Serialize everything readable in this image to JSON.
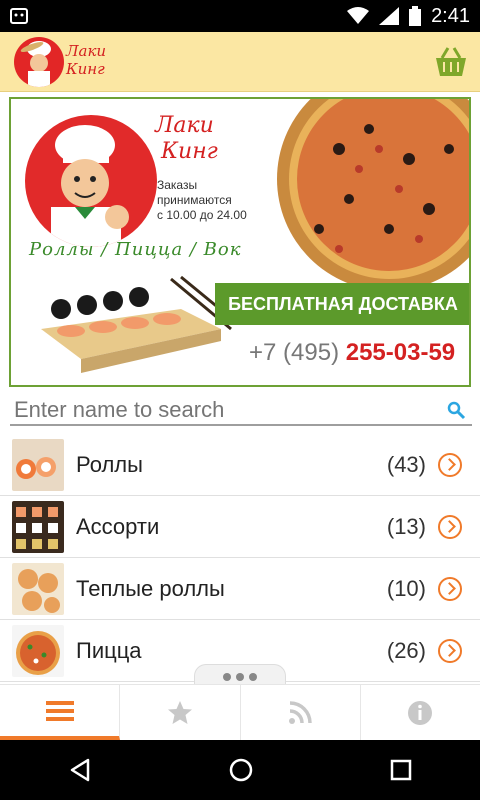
{
  "status_bar": {
    "time": "2:41"
  },
  "app_bar": {
    "logo_line1": "Лаки",
    "logo_line2": "Кинг"
  },
  "banner": {
    "brand_line1": "Лаки",
    "brand_line2": "Кинг",
    "orders_line1": "Заказы",
    "orders_line2": "принимаются",
    "orders_line3": "с 10.00 до 24.00",
    "categories_line": "Роллы / Пицца / Вок",
    "delivery_text": "БЕСПЛАТНАЯ ДОСТАВКА",
    "phone_prefix": "+7 (495)",
    "phone_number": "255-03-59"
  },
  "search": {
    "placeholder": "Enter name to search",
    "value": ""
  },
  "categories": [
    {
      "label": "Роллы",
      "count": "(43)"
    },
    {
      "label": "Ассорти",
      "count": "(13)"
    },
    {
      "label": "Теплые роллы",
      "count": "(10)"
    },
    {
      "label": "Пицца",
      "count": "(26)"
    }
  ],
  "colors": {
    "accent": "#f07a2a",
    "brand_red": "#d42121",
    "green": "#5c9a2b",
    "app_bar": "#fbe7a3"
  },
  "tabs": [
    {
      "icon": "menu-icon",
      "active": true
    },
    {
      "icon": "star-icon",
      "active": false
    },
    {
      "icon": "rss-icon",
      "active": false
    },
    {
      "icon": "info-icon",
      "active": false
    }
  ]
}
